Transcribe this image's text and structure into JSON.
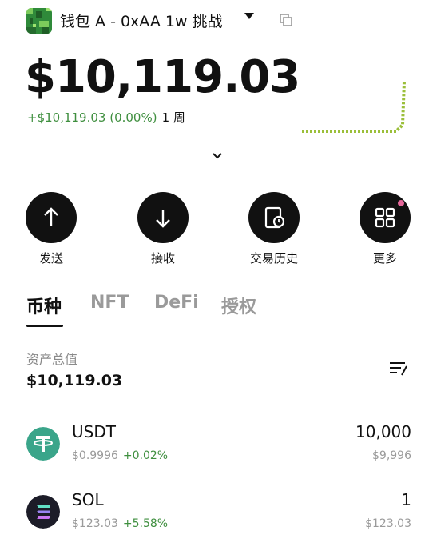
{
  "header": {
    "wallet_title": "钱包 A - 0xAA 1w 挑战"
  },
  "balance": {
    "total": "$10,119.03",
    "change_amount": "+$10,119.03 (0.00%)",
    "period": "1 周"
  },
  "actions": [
    {
      "label": "发送",
      "icon": "arrow-up-icon"
    },
    {
      "label": "接收",
      "icon": "arrow-down-icon"
    },
    {
      "label": "交易历史",
      "icon": "history-icon"
    },
    {
      "label": "更多",
      "icon": "grid-icon"
    }
  ],
  "tabs": [
    {
      "label": "币种",
      "active": true
    },
    {
      "label": "NFT",
      "active": false
    },
    {
      "label": "DeFi",
      "active": false
    },
    {
      "label": "授权",
      "active": false
    }
  ],
  "totals": {
    "label": "资产总值",
    "value": "$10,119.03"
  },
  "assets": [
    {
      "symbol": "USDT",
      "price": "$0.9996",
      "change": "+0.02%",
      "amount": "10,000",
      "value": "$9,996",
      "color": "#3aa58a"
    },
    {
      "symbol": "SOL",
      "price": "$123.03",
      "change": "+5.58%",
      "amount": "1",
      "value": "$123.03",
      "color": "#1c1c28"
    }
  ],
  "colors": {
    "positive": "#3f8f3f",
    "sparkline": "#9bbf3a",
    "badge": "#e6679a"
  }
}
